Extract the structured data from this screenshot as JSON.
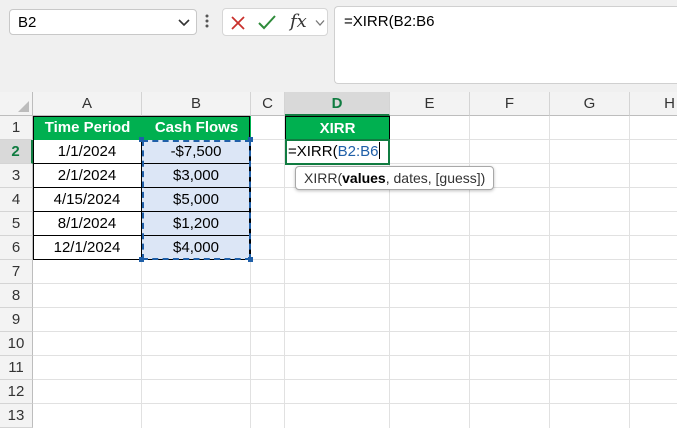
{
  "name_box": {
    "value": "B2"
  },
  "formula_bar": {
    "fx_label": "fx",
    "content": "=XIRR(B2:B6"
  },
  "columns": [
    "A",
    "B",
    "C",
    "D",
    "E",
    "F",
    "G",
    "H"
  ],
  "rows": [
    "1",
    "2",
    "3",
    "4",
    "5",
    "6",
    "7",
    "8",
    "9",
    "10",
    "11",
    "12",
    "13"
  ],
  "table": {
    "headers": [
      "Time Period",
      "Cash Flows"
    ],
    "rows": [
      [
        "1/1/2024",
        "-$7,500"
      ],
      [
        "2/1/2024",
        "$3,000"
      ],
      [
        "4/15/2024",
        "$5,000"
      ],
      [
        "8/1/2024",
        "$1,200"
      ],
      [
        "12/1/2024",
        "$4,000"
      ]
    ]
  },
  "xirr": {
    "header": "XIRR",
    "formula_prefix": "=XIRR(",
    "formula_ref": "B2:B6"
  },
  "tooltip": {
    "fn": "XIRR(",
    "arg1": "values",
    "rest": ", dates, [guess])"
  },
  "colors": {
    "header_green": "#00b050",
    "selection_green": "#107c41",
    "reference_blue": "#1f5fa8",
    "flow_fill": "#dce6f6"
  }
}
